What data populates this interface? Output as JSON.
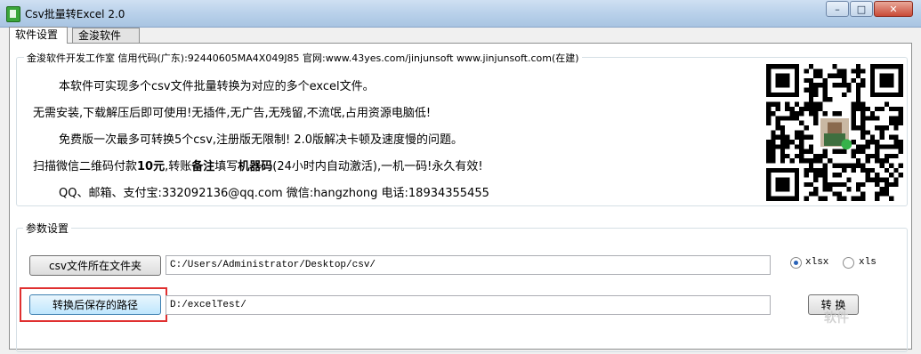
{
  "window": {
    "title": "Csv批量转Excel 2.0",
    "min_glyph": "–",
    "max_glyph": "□",
    "close_glyph": "✕"
  },
  "tabs": [
    {
      "label": "软件设置",
      "active": true
    },
    {
      "label": "金浚软件",
      "active": false
    }
  ],
  "info": {
    "group_title": "金浚软件开发工作室 信用代码(广东):92440605MA4X049J85 官网:www.43yes.com/jinjunsoft  www.jinjunsoft.com(在建)",
    "line1": "本软件可实现多个csv文件批量转换为对应的多个excel文件。",
    "line2": "无需安装,下载解压后即可使用!无插件,无广告,无残留,不流氓,占用资源电脑低!",
    "line3": "免费版一次最多可转换5个csv,注册版无限制! 2.0版解决卡顿及速度慢的问题。",
    "line4_a": "扫描微信二维码付款",
    "line4_b": "10元",
    "line4_c": ",转账",
    "line4_d": "备注",
    "line4_e": "填写",
    "line4_f": "机器码",
    "line4_g": "(24小时内自动激活),一机一码!永久有效!",
    "line5": "QQ、邮箱、支付宝:332092136@qq.com    微信:hangzhong    电话:18934355455"
  },
  "params": {
    "group_title": "参数设置",
    "folder_button": "csv文件所在文件夹",
    "folder_path": "C:/Users/Administrator/Desktop/csv/",
    "save_button": "转换后保存的路径",
    "save_path": "D:/excelTest/",
    "format_options": [
      {
        "label": "xlsx",
        "checked": true
      },
      {
        "label": "xls",
        "checked": false
      }
    ],
    "convert_button": "转 换"
  },
  "watermark": "软件"
}
